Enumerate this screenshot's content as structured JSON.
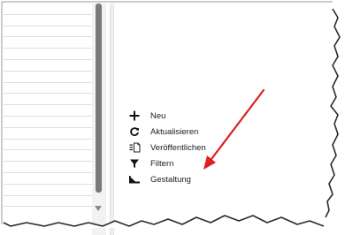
{
  "context_menu": {
    "items": [
      {
        "label": "Neu",
        "icon": "plus-icon"
      },
      {
        "label": "Aktualisieren",
        "icon": "refresh-icon"
      },
      {
        "label": "Veröffentlichen",
        "icon": "publish-icon"
      },
      {
        "label": "Filtern",
        "icon": "filter-icon"
      },
      {
        "label": "Gestaltung",
        "icon": "design-icon"
      }
    ]
  },
  "annotation": {
    "arrow_color": "#e02020"
  }
}
